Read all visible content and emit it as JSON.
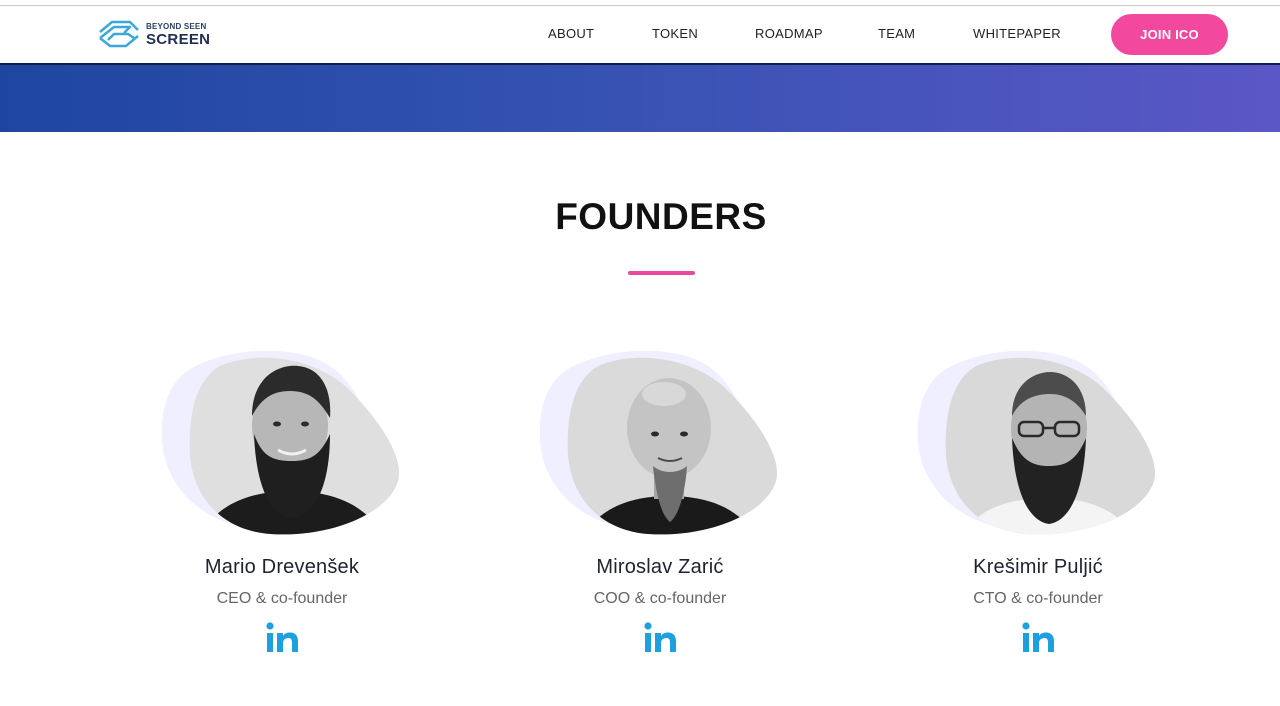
{
  "brand": {
    "logo_small": "BEYOND SEEN",
    "logo_big": "SCREEN"
  },
  "nav": {
    "items": [
      {
        "label": "ABOUT"
      },
      {
        "label": "TOKEN"
      },
      {
        "label": "ROADMAP"
      },
      {
        "label": "TEAM"
      },
      {
        "label": "WHITEPAPER"
      }
    ],
    "cta_label": "JOIN ICO"
  },
  "colors": {
    "accent_pink": "#f2499f",
    "banner_start": "#1e46a0",
    "banner_end": "#5b57c6",
    "linkedin_blue": "#1d9fe0"
  },
  "section": {
    "title": "FOUNDERS"
  },
  "founders": [
    {
      "name": "Mario Drevenšek",
      "role": "CEO & co-founder",
      "icon": "linkedin-icon"
    },
    {
      "name": "Miroslav Zarić",
      "role": "COO & co-founder",
      "icon": "linkedin-icon"
    },
    {
      "name": "Krešimir Puljić",
      "role": "CTO & co-founder",
      "icon": "linkedin-icon"
    }
  ]
}
